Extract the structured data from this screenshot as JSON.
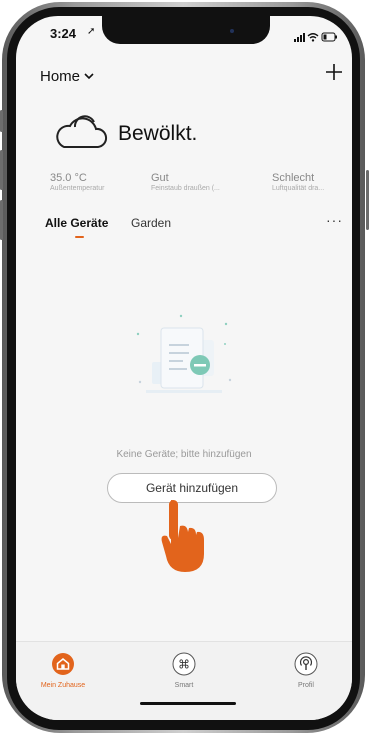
{
  "status_bar": {
    "time": "3:24",
    "location_glyph": "➚"
  },
  "header": {
    "home_label": "Home",
    "add_icon": "plus-icon"
  },
  "weather": {
    "condition": "Bewölkt.",
    "icon": "cloud-icon"
  },
  "metrics": [
    {
      "value": "35.0 °C",
      "label": "Außentemperatur"
    },
    {
      "value": "Gut",
      "label": "Feinstaub draußen (..."
    },
    {
      "value": "Schlecht",
      "label": "Luftqualität dra..."
    }
  ],
  "tabs": {
    "all": "Alle Geräte",
    "garden": "Garden",
    "more": "···"
  },
  "empty_state": {
    "message": "Keine Geräte; bitte hinzufügen",
    "button": "Gerät hinzufügen"
  },
  "bottom_nav": [
    {
      "label": "Mein Zuhause",
      "icon": "house-icon",
      "active": true
    },
    {
      "label": "Smart",
      "icon": "command-icon",
      "active": false
    },
    {
      "label": "Profil",
      "icon": "profile-icon",
      "active": false
    }
  ],
  "colors": {
    "accent": "#e2641c",
    "background": "#f6f6f6"
  }
}
